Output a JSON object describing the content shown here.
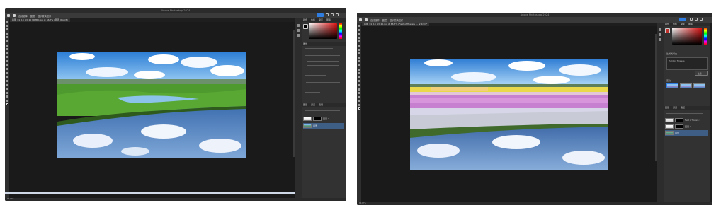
{
  "left_window": {
    "app_title": "Adobe Photoshop 2024",
    "doc_tab": "截图_01_18_13_20 NIMBO.jpg @ 66.7% (图层, RGB/8)",
    "options": [
      "自动选择",
      "图层",
      "显示变换控件"
    ],
    "panel_tabs": [
      "颜色",
      "色板",
      "渐变",
      "图案"
    ],
    "props_title": "属性",
    "layers_tabs": [
      "图层",
      "通道",
      "路径"
    ],
    "layers": [
      {
        "name": "图层 1",
        "thumb": "sky"
      },
      {
        "name": "背景",
        "thumb": "landscape"
      }
    ],
    "status": "66.67%"
  },
  "right_window": {
    "app_title": "Adobe Photoshop 2024",
    "doc_tab": "截图_01_18_13_20.jpg @ 66.7% (Field of flowers 1, 蒙版/8) *",
    "options": [
      "自动选择",
      "图层",
      "显示变换控件"
    ],
    "panel_tabs": [
      "颜色",
      "色板",
      "渐变",
      "图案"
    ],
    "generate_label": "生成式填充",
    "prompt_value": "Field of flowers",
    "generate_button": "生成",
    "variations_label": "变化",
    "layers_tabs": [
      "图层",
      "通道",
      "路径"
    ],
    "layers": [
      {
        "name": "Field of flowers 1",
        "thumb": "flowers"
      },
      {
        "name": "图层 1",
        "thumb": "sky"
      },
      {
        "name": "背景",
        "thumb": "landscape"
      }
    ],
    "status": "66.67%"
  },
  "colors": {
    "app_bg": "#1e1e1e",
    "panel_bg": "#323232",
    "accent": "#2f7de1",
    "foreground_color": "#c0302b"
  }
}
